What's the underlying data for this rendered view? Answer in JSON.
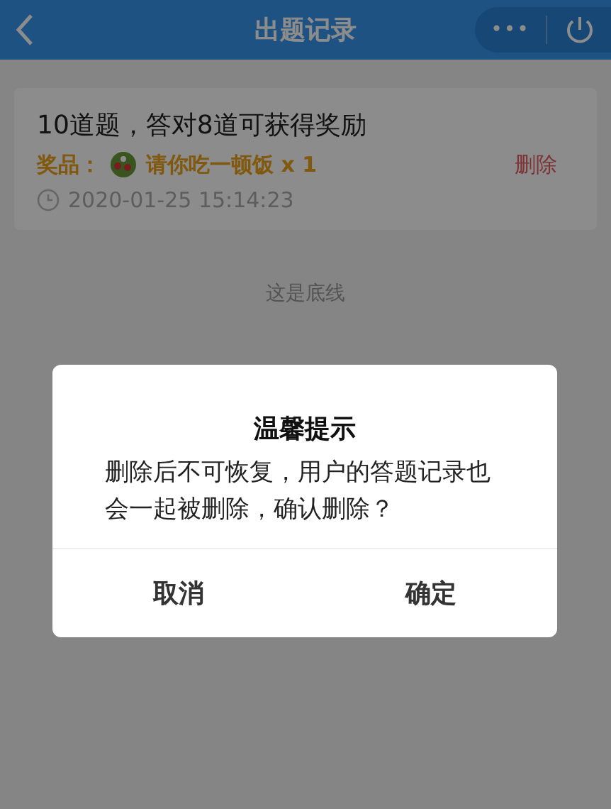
{
  "header": {
    "title": "出题记录",
    "menu": "•••"
  },
  "records": [
    {
      "title": "10道题，答对8道可获得奖励",
      "prize_label": "奖品：",
      "prize": "请你吃一顿饭 x 1",
      "delete": "删除",
      "time": "2020-01-25 15:14:23"
    }
  ],
  "end_note": "这是底线",
  "dialog": {
    "title": "温馨提示",
    "message": "删除后不可恢复，用户的答题记录也会一起被删除，确认删除？",
    "buttons": [
      "取消",
      "确定"
    ]
  }
}
